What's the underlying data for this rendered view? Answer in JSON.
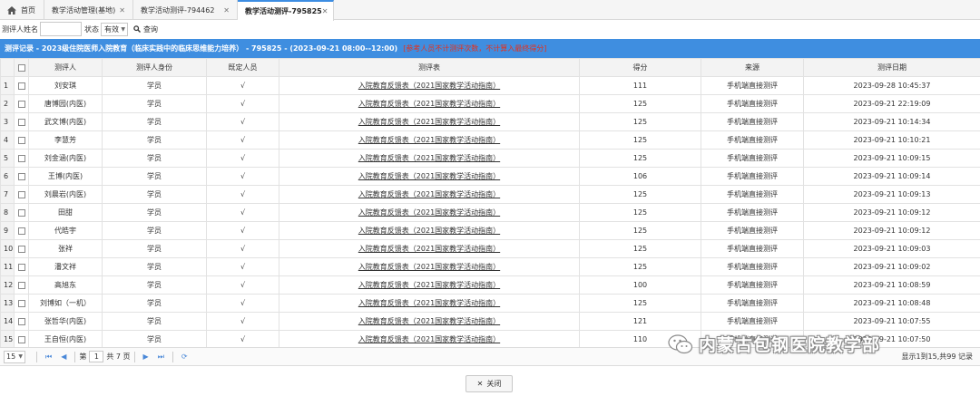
{
  "tabs": [
    {
      "label": "首页"
    },
    {
      "label": "教学活动管理(基地)"
    },
    {
      "label": "教学活动测评-794462"
    },
    {
      "label": "教学活动测评-795825"
    }
  ],
  "search": {
    "name_label": "测评人姓名",
    "name_value": "",
    "status_label": "状态",
    "status_value": "有效",
    "query_label": "查询"
  },
  "title": {
    "main": "测评记录 - 2023级住院医师入院教育（临床实践中的临床思维能力培养） - 795825 - (2023-09-21 08:00--12:00)",
    "warning": "[参考人员不计测评次数，不计算入最终得分]"
  },
  "table": {
    "headers": [
      "测评人",
      "测评人身份",
      "既定人员",
      "测评表",
      "得分",
      "来源",
      "测评日期"
    ],
    "rows": [
      {
        "n": "1",
        "name": "刘安琪",
        "role": "学员",
        "fixed": "√",
        "form": "入院教育反馈表（2021国家教学活动指南）",
        "score": "111",
        "source": "手机端直接测评",
        "date": "2023-09-28 10:45:37"
      },
      {
        "n": "2",
        "name": "唐博园(内医)",
        "role": "学员",
        "fixed": "√",
        "form": "入院教育反馈表（2021国家教学活动指南）",
        "score": "125",
        "source": "手机端直接测评",
        "date": "2023-09-21 22:19:09"
      },
      {
        "n": "3",
        "name": "武文博(内医)",
        "role": "学员",
        "fixed": "√",
        "form": "入院教育反馈表（2021国家教学活动指南）",
        "score": "125",
        "source": "手机端直接测评",
        "date": "2023-09-21 10:14:34"
      },
      {
        "n": "4",
        "name": "李慧芳",
        "role": "学员",
        "fixed": "√",
        "form": "入院教育反馈表（2021国家教学活动指南）",
        "score": "125",
        "source": "手机端直接测评",
        "date": "2023-09-21 10:10:21"
      },
      {
        "n": "5",
        "name": "刘金涵(内医)",
        "role": "学员",
        "fixed": "√",
        "form": "入院教育反馈表（2021国家教学活动指南）",
        "score": "125",
        "source": "手机端直接测评",
        "date": "2023-09-21 10:09:15"
      },
      {
        "n": "6",
        "name": "王博(内医)",
        "role": "学员",
        "fixed": "√",
        "form": "入院教育反馈表（2021国家教学活动指南）",
        "score": "106",
        "source": "手机端直接测评",
        "date": "2023-09-21 10:09:14"
      },
      {
        "n": "7",
        "name": "刘晨岩(内医)",
        "role": "学员",
        "fixed": "√",
        "form": "入院教育反馈表（2021国家教学活动指南）",
        "score": "125",
        "source": "手机端直接测评",
        "date": "2023-09-21 10:09:13"
      },
      {
        "n": "8",
        "name": "田甜",
        "role": "学员",
        "fixed": "√",
        "form": "入院教育反馈表（2021国家教学活动指南）",
        "score": "125",
        "source": "手机端直接测评",
        "date": "2023-09-21 10:09:12"
      },
      {
        "n": "9",
        "name": "代皓宇",
        "role": "学员",
        "fixed": "√",
        "form": "入院教育反馈表（2021国家教学活动指南）",
        "score": "125",
        "source": "手机端直接测评",
        "date": "2023-09-21 10:09:12"
      },
      {
        "n": "10",
        "name": "张祥",
        "role": "学员",
        "fixed": "√",
        "form": "入院教育反馈表（2021国家教学活动指南）",
        "score": "125",
        "source": "手机端直接测评",
        "date": "2023-09-21 10:09:03"
      },
      {
        "n": "11",
        "name": "潘文祥",
        "role": "学员",
        "fixed": "√",
        "form": "入院教育反馈表（2021国家教学活动指南）",
        "score": "125",
        "source": "手机端直接测评",
        "date": "2023-09-21 10:09:02"
      },
      {
        "n": "12",
        "name": "高旭东",
        "role": "学员",
        "fixed": "√",
        "form": "入院教育反馈表（2021国家教学活动指南）",
        "score": "100",
        "source": "手机端直接测评",
        "date": "2023-09-21 10:08:59"
      },
      {
        "n": "13",
        "name": "刘博如（一机）",
        "role": "学员",
        "fixed": "√",
        "form": "入院教育反馈表（2021国家教学活动指南）",
        "score": "125",
        "source": "手机端直接测评",
        "date": "2023-09-21 10:08:48"
      },
      {
        "n": "14",
        "name": "张哲华(内医)",
        "role": "学员",
        "fixed": "√",
        "form": "入院教育反馈表（2021国家教学活动指南）",
        "score": "121",
        "source": "手机端直接测评",
        "date": "2023-09-21 10:07:55"
      },
      {
        "n": "15",
        "name": "王自恒(内医)",
        "role": "学员",
        "fixed": "√",
        "form": "入院教育反馈表（2021国家教学活动指南）",
        "score": "110",
        "source": "手机端直接测评",
        "date": "2023-09-21 10:07:50"
      }
    ]
  },
  "pager": {
    "page_size": "15",
    "page_label": "第",
    "page_value": "1",
    "total_pages": "共 7 页",
    "info": "显示1到15,共99 记录"
  },
  "footer": {
    "close_label": "关闭"
  },
  "watermark": {
    "text": "内蒙古包钢医院教学部"
  },
  "colors": {
    "accent": "#3f8ee0",
    "warning": "#e8301a"
  }
}
